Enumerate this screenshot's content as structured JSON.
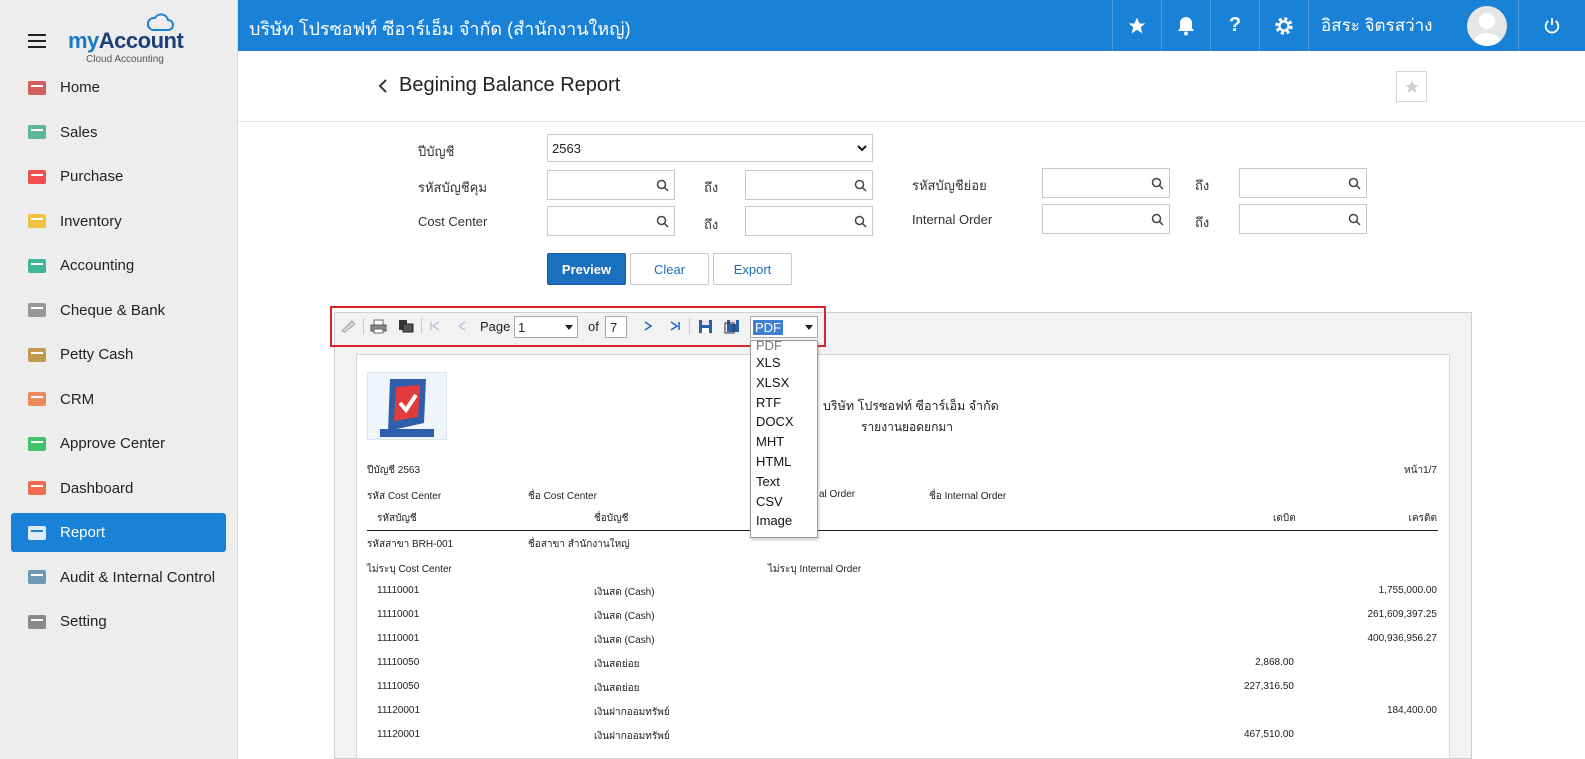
{
  "app": {
    "brand_my": "my",
    "brand_account": "Account",
    "brand_sub": "Cloud Accounting"
  },
  "sidebar": {
    "items": [
      {
        "label": "Home",
        "icon": "home-icon"
      },
      {
        "label": "Sales",
        "icon": "sales-icon"
      },
      {
        "label": "Purchase",
        "icon": "cart-icon"
      },
      {
        "label": "Inventory",
        "icon": "box-icon"
      },
      {
        "label": "Accounting",
        "icon": "book-icon"
      },
      {
        "label": "Cheque & Bank",
        "icon": "bank-icon"
      },
      {
        "label": "Petty Cash",
        "icon": "wallet-icon"
      },
      {
        "label": "CRM",
        "icon": "crm-icon"
      },
      {
        "label": "Approve Center",
        "icon": "check-icon"
      },
      {
        "label": "Dashboard",
        "icon": "pie-chart-icon"
      },
      {
        "label": "Report",
        "icon": "report-icon"
      },
      {
        "label": "Audit & Internal Control",
        "icon": "magnifier-icon"
      },
      {
        "label": "Setting",
        "icon": "tools-icon"
      }
    ],
    "active": "Report"
  },
  "topbar": {
    "company": "บริษัท โปรซอฟท์ ซีอาร์เอ็ม จำกัด (สำนักงานใหญ่)",
    "user": "อิสระ จิตรสว่าง"
  },
  "page": {
    "title": "Begining Balance Report"
  },
  "form": {
    "fiscal_year_label": "ปีบัญชี",
    "fiscal_year_value": "2563",
    "control_account_label": "รหัสบัญชีคุม",
    "to_label": "ถึง",
    "sub_account_label": "รหัสบัญชีย่อย",
    "cost_center_label": "Cost Center",
    "internal_order_label": "Internal Order",
    "preview": "Preview",
    "clear": "Clear",
    "export": "Export"
  },
  "viewer": {
    "page_label": "Page",
    "page_value": "1",
    "of_label": "of",
    "page_total": "7",
    "format_selected": "PDF",
    "formats": [
      "PDF",
      "XLS",
      "XLSX",
      "RTF",
      "DOCX",
      "MHT",
      "HTML",
      "Text",
      "CSV",
      "Image"
    ]
  },
  "report": {
    "company": "บริษัท โปรซอฟท์ ซีอาร์เอ็ม จำกัด",
    "title": "รายงานยอดยกมา",
    "year": "ปีบัญชี 2563",
    "page": "หน้า1/7",
    "hdr_cc_code": "รหัส Cost Center",
    "hdr_cc_name": "ชื่อ Cost Center",
    "hdr_io_code": "al Order",
    "hdr_io_name": "ชื่อ Internal Order",
    "col_account_code": "รหัสบัญชี",
    "col_account_name": "ชื่อบัญชี",
    "col_debit": "เดบิต",
    "col_credit": "เครดิต",
    "branch_code": "รหัสสาขา BRH-001",
    "branch_name": "ชื่อสาขา สำนักงานใหญ่",
    "no_cc": "ไม่ระบุ Cost Center",
    "no_io": "ไม่ระบุ Internal Order",
    "rows": [
      {
        "code": "11110001",
        "name": "เงินสด (Cash)",
        "debit": "",
        "credit": "1,755,000.00"
      },
      {
        "code": "11110001",
        "name": "เงินสด (Cash)",
        "debit": "",
        "credit": "261,609,397.25"
      },
      {
        "code": "11110001",
        "name": "เงินสด (Cash)",
        "debit": "",
        "credit": "400,936,956.27"
      },
      {
        "code": "11110050",
        "name": "เงินสดย่อย",
        "debit": "2,868.00",
        "credit": ""
      },
      {
        "code": "11110050",
        "name": "เงินสดย่อย",
        "debit": "227,316.50",
        "credit": ""
      },
      {
        "code": "11120001",
        "name": "เงินฝากออมทรัพย์",
        "debit": "",
        "credit": "184,400.00"
      },
      {
        "code": "11120001",
        "name": "เงินฝากออมทรัพย์",
        "debit": "467,510.00",
        "credit": ""
      }
    ]
  },
  "colors": {
    "primary": "#1a82d6",
    "button": "#1a6fbf",
    "highlight": "#d9252a"
  }
}
